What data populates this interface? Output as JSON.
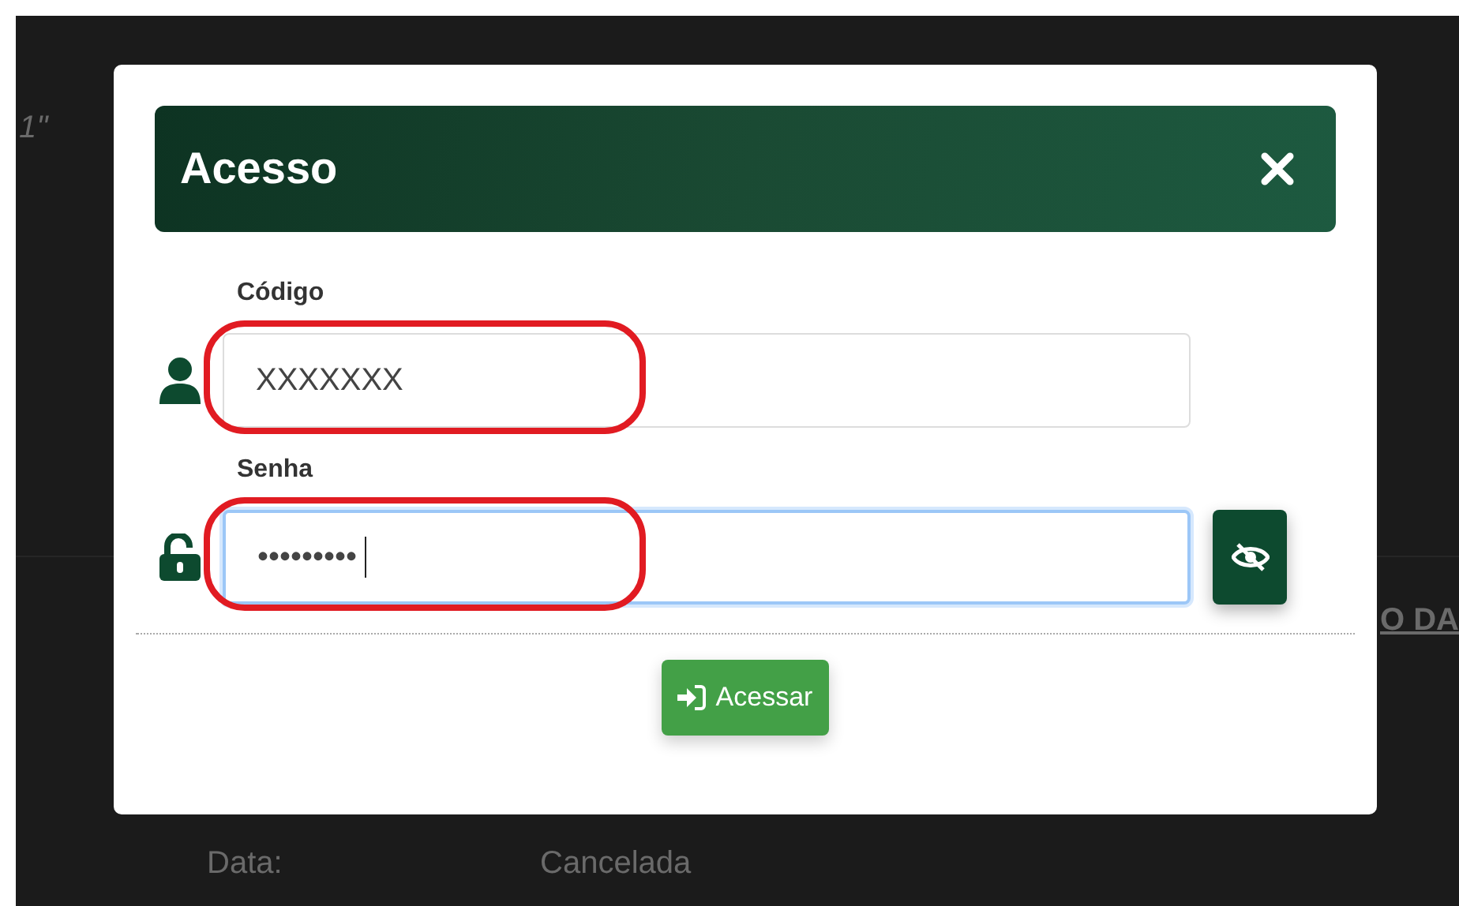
{
  "background": {
    "texts": [
      {
        "kind": "mark",
        "text": "1\""
      },
      {
        "kind": "heading",
        "text": "O DA"
      },
      {
        "kind": "label",
        "text": "Data:"
      },
      {
        "kind": "value",
        "text": "Cancelada"
      }
    ]
  },
  "dialog": {
    "title": "Acesso",
    "fields": [
      {
        "kind": "user",
        "label": "Código",
        "value": "XXXXXXX",
        "focused": false,
        "highlighted": true
      },
      {
        "kind": "password",
        "label": "Senha",
        "value": "•••••••••",
        "focused": true,
        "highlighted": true
      }
    ],
    "submit": "Acessar"
  }
}
